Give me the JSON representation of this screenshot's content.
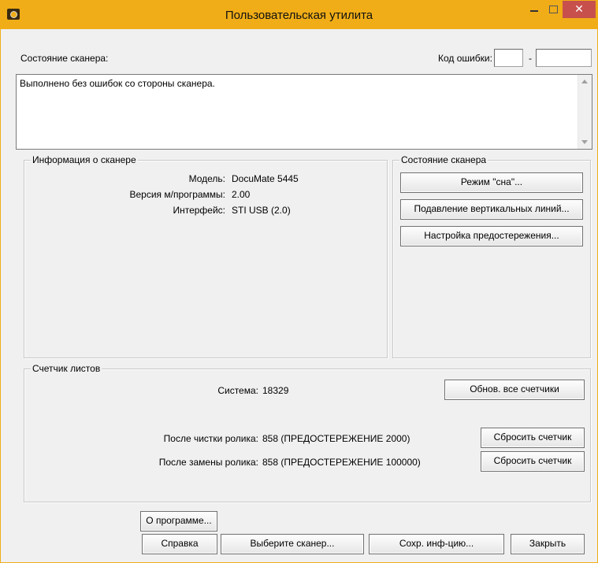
{
  "window": {
    "title": "Пользовательская утилита",
    "close_symbol": "✕",
    "accent": "#f0ad17"
  },
  "status": {
    "label": "Состояние сканера:",
    "error_code_label": "Код ошибки:",
    "error_code_dash": "-",
    "error_code_1": "",
    "error_code_2": "",
    "message": "Выполнено без ошибок со стороны сканера."
  },
  "info": {
    "title": "Информация о сканере",
    "rows": [
      {
        "label": "Модель:",
        "value": "DocuMate 5445"
      },
      {
        "label": "Версия м/программы:",
        "value": "2.00"
      },
      {
        "label": "Интерфейс:",
        "value": "STI USB (2.0)"
      }
    ]
  },
  "scanner_state": {
    "title": "Состояние сканера",
    "sleep_button": "Режим \"сна\"...",
    "lines_button": "Подавление вертикальных линий...",
    "warning_button": "Настройка предостережения..."
  },
  "counter": {
    "title": "Счетчик листов",
    "system_label": "Система:",
    "system_value": "18329",
    "update_all_button": "Обнов. все счетчики",
    "clean_label": "После чистки ролика:",
    "clean_value": "858 (ПРЕДОСТЕРЕЖЕНИЕ 2000)",
    "replace_label": "После замены ролика:",
    "replace_value": "858 (ПРЕДОСТЕРЕЖЕНИЕ 100000)",
    "reset_button": "Сбросить счетчик"
  },
  "footer": {
    "about": "О программе...",
    "help": "Справка",
    "select_scanner": "Выберите сканер...",
    "save_info": "Сохр. инф-цию...",
    "close": "Закрыть"
  }
}
